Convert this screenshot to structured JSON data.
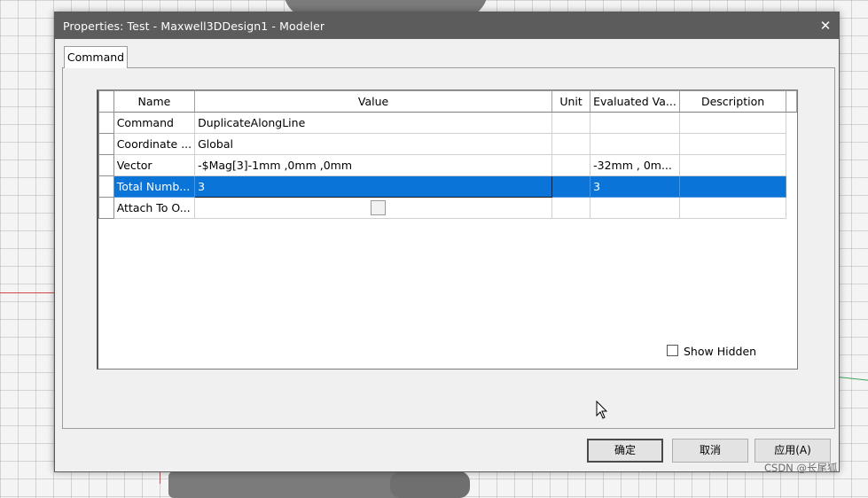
{
  "dialog": {
    "title": "Properties: Test - Maxwell3DDesign1 - Modeler",
    "close_glyph": "✕"
  },
  "tabs": [
    {
      "label": "Command",
      "active": true
    }
  ],
  "grid": {
    "columns": [
      "Name",
      "Value",
      "Unit",
      "Evaluated Va...",
      "Description"
    ],
    "rows": [
      {
        "name": "Command",
        "value": "DuplicateAlongLine",
        "unit": "",
        "evaluated": "",
        "description": "",
        "selected": false
      },
      {
        "name": "Coordinate ...",
        "value": "Global",
        "unit": "",
        "evaluated": "",
        "description": "",
        "selected": false
      },
      {
        "name": "Vector",
        "value": "-$Mag[3]-1mm ,0mm ,0mm",
        "unit": "",
        "evaluated": "-32mm , 0m...",
        "description": "",
        "selected": false
      },
      {
        "name": "Total Numb...",
        "value": "3",
        "unit": "",
        "evaluated": "3",
        "description": "",
        "selected": true
      },
      {
        "name": "Attach To O...",
        "value": "",
        "unit": "",
        "evaluated": "",
        "description": "",
        "selected": false,
        "checkbox": true,
        "checked": false
      }
    ]
  },
  "show_hidden": {
    "label": "Show Hidden",
    "checked": false
  },
  "buttons": {
    "ok": "确定",
    "cancel": "取消",
    "apply": "应用(A)"
  },
  "watermark": "CSDN @长尾狐",
  "colors": {
    "selection": "#0a74d9",
    "titlebar": "#5c5c5c"
  }
}
